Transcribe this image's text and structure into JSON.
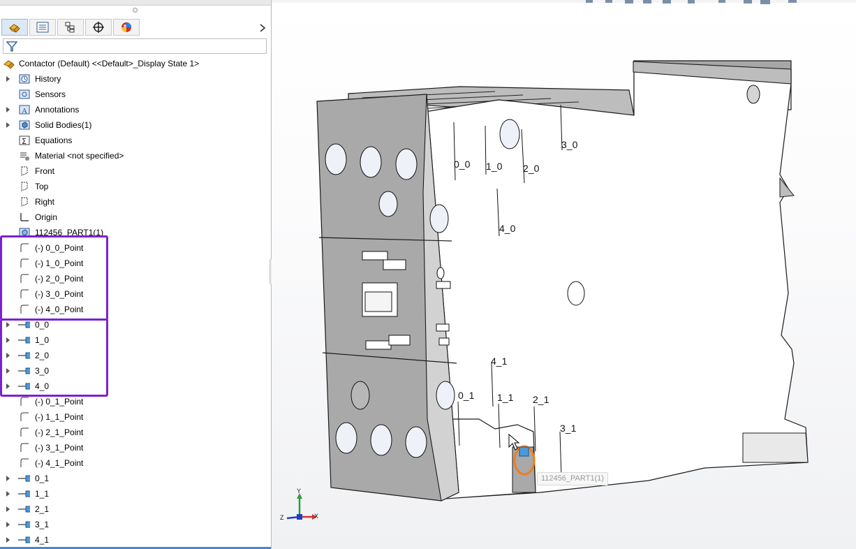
{
  "feature_manager": {
    "tabs": [
      {
        "name": "feature-manager-tab",
        "active": true
      },
      {
        "name": "property-manager-tab",
        "active": false
      },
      {
        "name": "configuration-manager-tab",
        "active": false
      },
      {
        "name": "dimxpert-manager-tab",
        "active": false
      },
      {
        "name": "display-manager-tab",
        "active": false
      }
    ],
    "root_label": "Contactor (Default) <<Default>_Display State 1>",
    "items": [
      {
        "label": "History",
        "icon": "history-folder-icon",
        "expandable": true
      },
      {
        "label": "Sensors",
        "icon": "sensors-icon",
        "expandable": false
      },
      {
        "label": "Annotations",
        "icon": "annotations-icon",
        "expandable": true
      },
      {
        "label": "Solid Bodies(1)",
        "icon": "solid-bodies-icon",
        "expandable": true
      },
      {
        "label": "Equations",
        "icon": "equations-icon",
        "expandable": false
      },
      {
        "label": "Material <not specified>",
        "icon": "material-icon",
        "expandable": false
      },
      {
        "label": "Front",
        "icon": "plane-icon",
        "expandable": false
      },
      {
        "label": "Top",
        "icon": "plane-icon",
        "expandable": false
      },
      {
        "label": "Right",
        "icon": "plane-icon",
        "expandable": false
      },
      {
        "label": "Origin",
        "icon": "origin-icon",
        "expandable": false
      },
      {
        "label": "112456_PART1(1)",
        "icon": "imported-part-icon",
        "expandable": false
      },
      {
        "label": "(-) 0_0_Point",
        "icon": "sketch-icon",
        "expandable": false
      },
      {
        "label": "(-) 1_0_Point",
        "icon": "sketch-icon",
        "expandable": false
      },
      {
        "label": "(-) 2_0_Point",
        "icon": "sketch-icon",
        "expandable": false
      },
      {
        "label": "(-) 3_0_Point",
        "icon": "sketch-icon",
        "expandable": false
      },
      {
        "label": "(-) 4_0_Point",
        "icon": "sketch-icon",
        "expandable": false
      },
      {
        "label": "0_0",
        "icon": "feature-icon",
        "expandable": true
      },
      {
        "label": "1_0",
        "icon": "feature-icon",
        "expandable": true
      },
      {
        "label": "2_0",
        "icon": "feature-icon",
        "expandable": true
      },
      {
        "label": "3_0",
        "icon": "feature-icon",
        "expandable": true
      },
      {
        "label": "4_0",
        "icon": "feature-icon",
        "expandable": true
      },
      {
        "label": "(-) 0_1_Point",
        "icon": "sketch-icon",
        "expandable": false
      },
      {
        "label": "(-) 1_1_Point",
        "icon": "sketch-icon",
        "expandable": false
      },
      {
        "label": "(-) 2_1_Point",
        "icon": "sketch-icon",
        "expandable": false
      },
      {
        "label": "(-) 3_1_Point",
        "icon": "sketch-icon",
        "expandable": false
      },
      {
        "label": "(-) 4_1_Point",
        "icon": "sketch-icon",
        "expandable": false
      },
      {
        "label": "0_1",
        "icon": "feature-icon",
        "expandable": true
      },
      {
        "label": "1_1",
        "icon": "feature-icon",
        "expandable": true
      },
      {
        "label": "2_1",
        "icon": "feature-icon",
        "expandable": true
      },
      {
        "label": "3_1",
        "icon": "feature-icon",
        "expandable": true
      },
      {
        "label": "4_1",
        "icon": "feature-icon",
        "expandable": true
      }
    ]
  },
  "graphics": {
    "callouts_top": [
      "0_0",
      "1_0",
      "2_0",
      "3_0",
      "4_0"
    ],
    "callouts_bottom": [
      "0_1",
      "1_1",
      "2_1",
      "3_1",
      "4_1"
    ],
    "tooltip": "112456_PART1(1)",
    "triad": {
      "x": "X",
      "y": "Y",
      "z": "Z"
    }
  },
  "colors": {
    "highlight_box": "#7b22d1",
    "selection_ring": "#f07d1a",
    "part_face_dark": "#a9a9a9",
    "part_face_light": "#ffffff"
  }
}
